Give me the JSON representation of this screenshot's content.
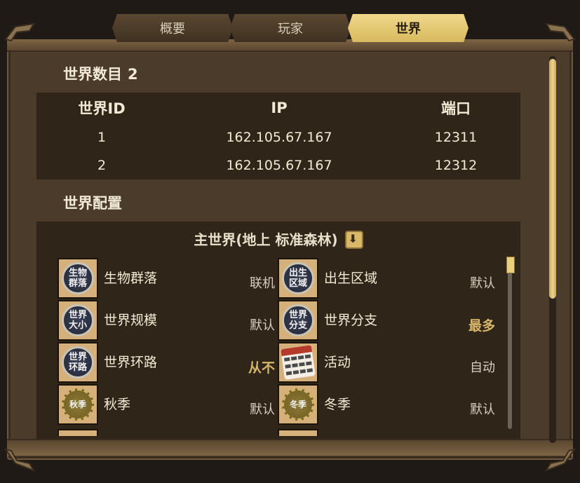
{
  "tabs": [
    {
      "label": "概要",
      "active": false
    },
    {
      "label": "玩家",
      "active": false
    },
    {
      "label": "世界",
      "active": true
    }
  ],
  "world_count": {
    "label": "世界数目",
    "value": "2"
  },
  "ip_table": {
    "headers": [
      "世界ID",
      "IP",
      "端口"
    ],
    "rows": [
      [
        "1",
        "162.105.67.167",
        "12311"
      ],
      [
        "2",
        "162.105.67.167",
        "12312"
      ]
    ]
  },
  "world_config": {
    "title": "世界配置",
    "subtitle": "主世界(地上 标准森林)",
    "options": [
      {
        "icon_text": "生物群落",
        "label": "生物群落",
        "value": "联机",
        "highlight": false
      },
      {
        "icon_text": "出生区域",
        "label": "出生区域",
        "value": "默认",
        "highlight": false
      },
      {
        "icon_text": "世界大小",
        "label": "世界规模",
        "value": "默认",
        "highlight": false
      },
      {
        "icon_text": "世界分支",
        "label": "世界分支",
        "value": "最多",
        "highlight": true
      },
      {
        "icon_text": "世界环路",
        "label": "世界环路",
        "value": "从不",
        "highlight": true
      },
      {
        "icon_text": "calendar-icon",
        "label": "活动",
        "value": "自动",
        "highlight": false
      },
      {
        "icon_text": "秋季",
        "label": "秋季",
        "value": "默认",
        "highlight": false
      },
      {
        "icon_text": "冬季",
        "label": "冬季",
        "value": "默认",
        "highlight": false
      }
    ]
  },
  "colors": {
    "tab_active": "#e6c777",
    "panel_bg": "#4a3b2b",
    "table_bg": "#2f2519",
    "highlight_value": "#d6b46a"
  }
}
